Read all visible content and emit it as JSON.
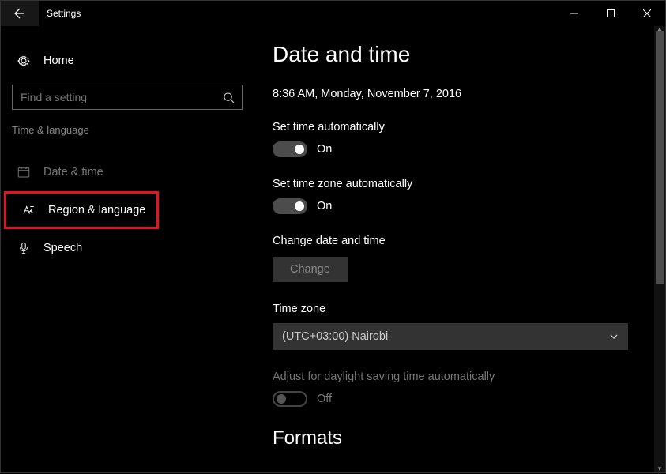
{
  "titlebar": {
    "title": "Settings"
  },
  "sidebar": {
    "home": "Home",
    "search_placeholder": "Find a setting",
    "section": "Time & language",
    "items": [
      {
        "label": "Date & time"
      },
      {
        "label": "Region & language"
      },
      {
        "label": "Speech"
      }
    ]
  },
  "main": {
    "heading": "Date and time",
    "current_datetime": "8:36 AM, Monday, November 7, 2016",
    "set_time_auto": {
      "label": "Set time automatically",
      "state": "On"
    },
    "set_tz_auto": {
      "label": "Set time zone automatically",
      "state": "On"
    },
    "change_dt": {
      "label": "Change date and time",
      "button": "Change"
    },
    "timezone": {
      "label": "Time zone",
      "value": "(UTC+03:00) Nairobi"
    },
    "dst": {
      "label": "Adjust for daylight saving time automatically",
      "state": "Off"
    },
    "formats_heading": "Formats"
  }
}
